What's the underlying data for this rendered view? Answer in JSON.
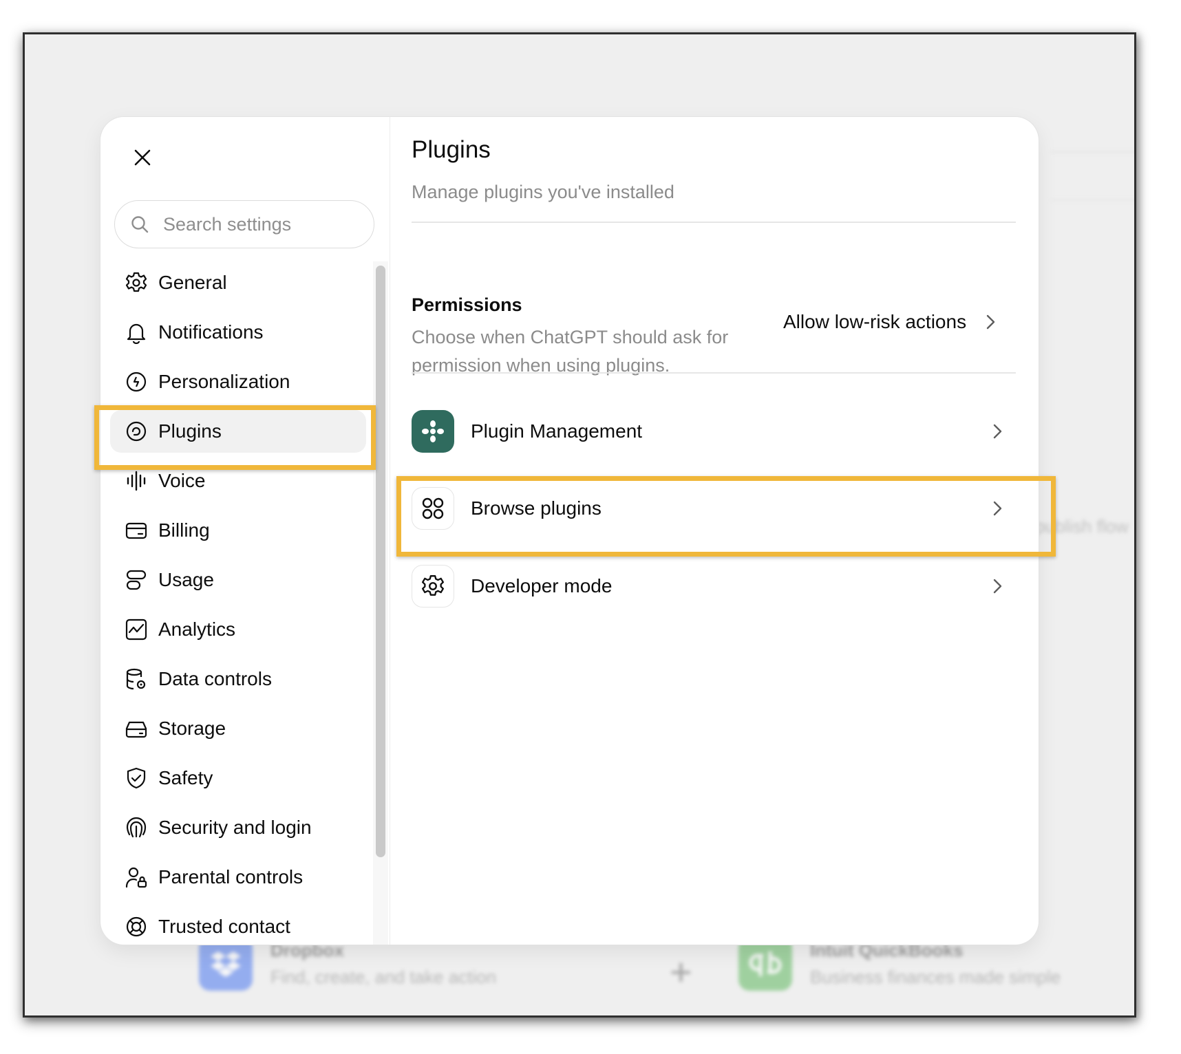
{
  "background": {
    "publish_text": "publish flow",
    "plus_glyph": "+",
    "apps": [
      {
        "name": "Dropbox",
        "description": "Find, create, and take action",
        "icon": "dropbox-icon",
        "color": "#4b78f0"
      },
      {
        "name": "Intuit QuickBooks",
        "description": "Business finances made simple",
        "icon": "quickbooks-icon",
        "color": "#5fb85f"
      }
    ]
  },
  "modal": {
    "close_icon": "close-icon",
    "search": {
      "placeholder": "Search settings"
    },
    "nav": [
      {
        "label": "General",
        "icon": "gear-icon"
      },
      {
        "label": "Notifications",
        "icon": "bell-icon"
      },
      {
        "label": "Personalization",
        "icon": "personalization-icon"
      },
      {
        "label": "Plugins",
        "icon": "plugins-icon",
        "active": true
      },
      {
        "label": "Voice",
        "icon": "voice-waveform-icon"
      },
      {
        "label": "Billing",
        "icon": "credit-card-icon"
      },
      {
        "label": "Usage",
        "icon": "usage-icon"
      },
      {
        "label": "Analytics",
        "icon": "analytics-chart-icon"
      },
      {
        "label": "Data controls",
        "icon": "database-gear-icon"
      },
      {
        "label": "Storage",
        "icon": "storage-drive-icon"
      },
      {
        "label": "Safety",
        "icon": "shield-check-icon"
      },
      {
        "label": "Security and login",
        "icon": "fingerprint-icon"
      },
      {
        "label": "Parental controls",
        "icon": "parental-lock-icon"
      },
      {
        "label": "Trusted contact",
        "icon": "lifebuoy-icon"
      }
    ]
  },
  "content": {
    "title": "Plugins",
    "subtitle": "Manage plugins you've installed",
    "permissions": {
      "title": "Permissions",
      "description": "Choose when ChatGPT should ask for permission when using plugins.",
      "value": "Allow low-risk actions"
    },
    "rows": [
      {
        "label": "Plugin Management",
        "icon": "plugin-management-icon",
        "icon_bg": "#2f6b5e"
      },
      {
        "label": "Browse plugins",
        "icon": "grid-circles-icon"
      },
      {
        "label": "Developer mode",
        "icon": "gear-icon"
      }
    ]
  },
  "highlight_color": "#f0b73a"
}
